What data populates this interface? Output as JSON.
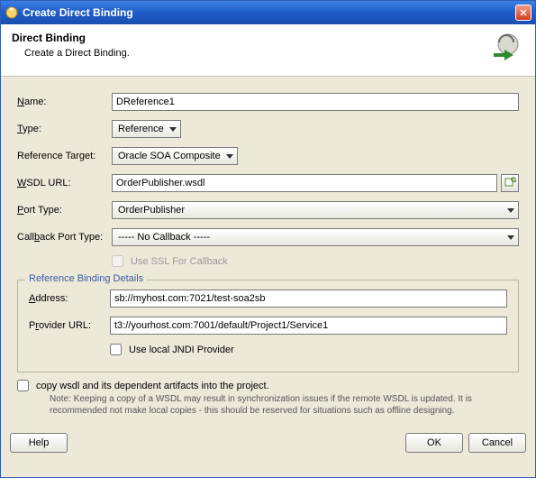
{
  "window": {
    "title": "Create Direct Binding"
  },
  "header": {
    "heading": "Direct Binding",
    "subtitle": "Create a Direct Binding."
  },
  "form": {
    "name": {
      "label_pre": "",
      "label_ul": "N",
      "label_post": "ame:",
      "value": "DReference1"
    },
    "type": {
      "label_pre": "",
      "label_ul": "T",
      "label_post": "ype:",
      "value": "Reference"
    },
    "refTarget": {
      "label_pre": "Reference Tar",
      "label_ul": "g",
      "label_post": "et:",
      "value": "Oracle SOA Composite"
    },
    "wsdl": {
      "label_pre": "",
      "label_ul": "W",
      "label_post": "SDL URL:",
      "value": "OrderPublisher.wsdl"
    },
    "portType": {
      "label_pre": "",
      "label_ul": "P",
      "label_post": "ort Type:",
      "value": "OrderPublisher"
    },
    "callback": {
      "label_pre": "Call",
      "label_ul": "b",
      "label_post": "ack Port Type:",
      "value": "----- No Callback -----"
    },
    "useSSL": {
      "label_pre": "Use ",
      "label_ul": "S",
      "label_post": "SL For Callback",
      "checked": false
    }
  },
  "details": {
    "legend": "Reference Binding Details",
    "address": {
      "label_pre": "",
      "label_ul": "A",
      "label_post": "ddress:",
      "value": "sb://myhost.com:7021/test-soa2sb"
    },
    "providerUrl": {
      "label_pre": "P",
      "label_ul": "r",
      "label_post": "ovider URL:",
      "value": "t3://yourhost.com:7001/default/Project1/Service1"
    },
    "useLocalJndi": {
      "label_pre": "Use local ",
      "label_ul": "J",
      "label_post": "NDI Provider",
      "checked": false
    }
  },
  "copyWsdl": {
    "label_pre": "",
    "label_ul": "c",
    "label_post": "opy wsdl and its dependent artifacts into the project.",
    "checked": false,
    "note": "Note: Keeping a copy of a WSDL may result in synchronization issues if the remote WSDL is updated. It is recommended not make local copies - this should be reserved for situations such as offline designing."
  },
  "buttons": {
    "help": "Help",
    "ok": "OK",
    "cancel": "Cancel"
  }
}
